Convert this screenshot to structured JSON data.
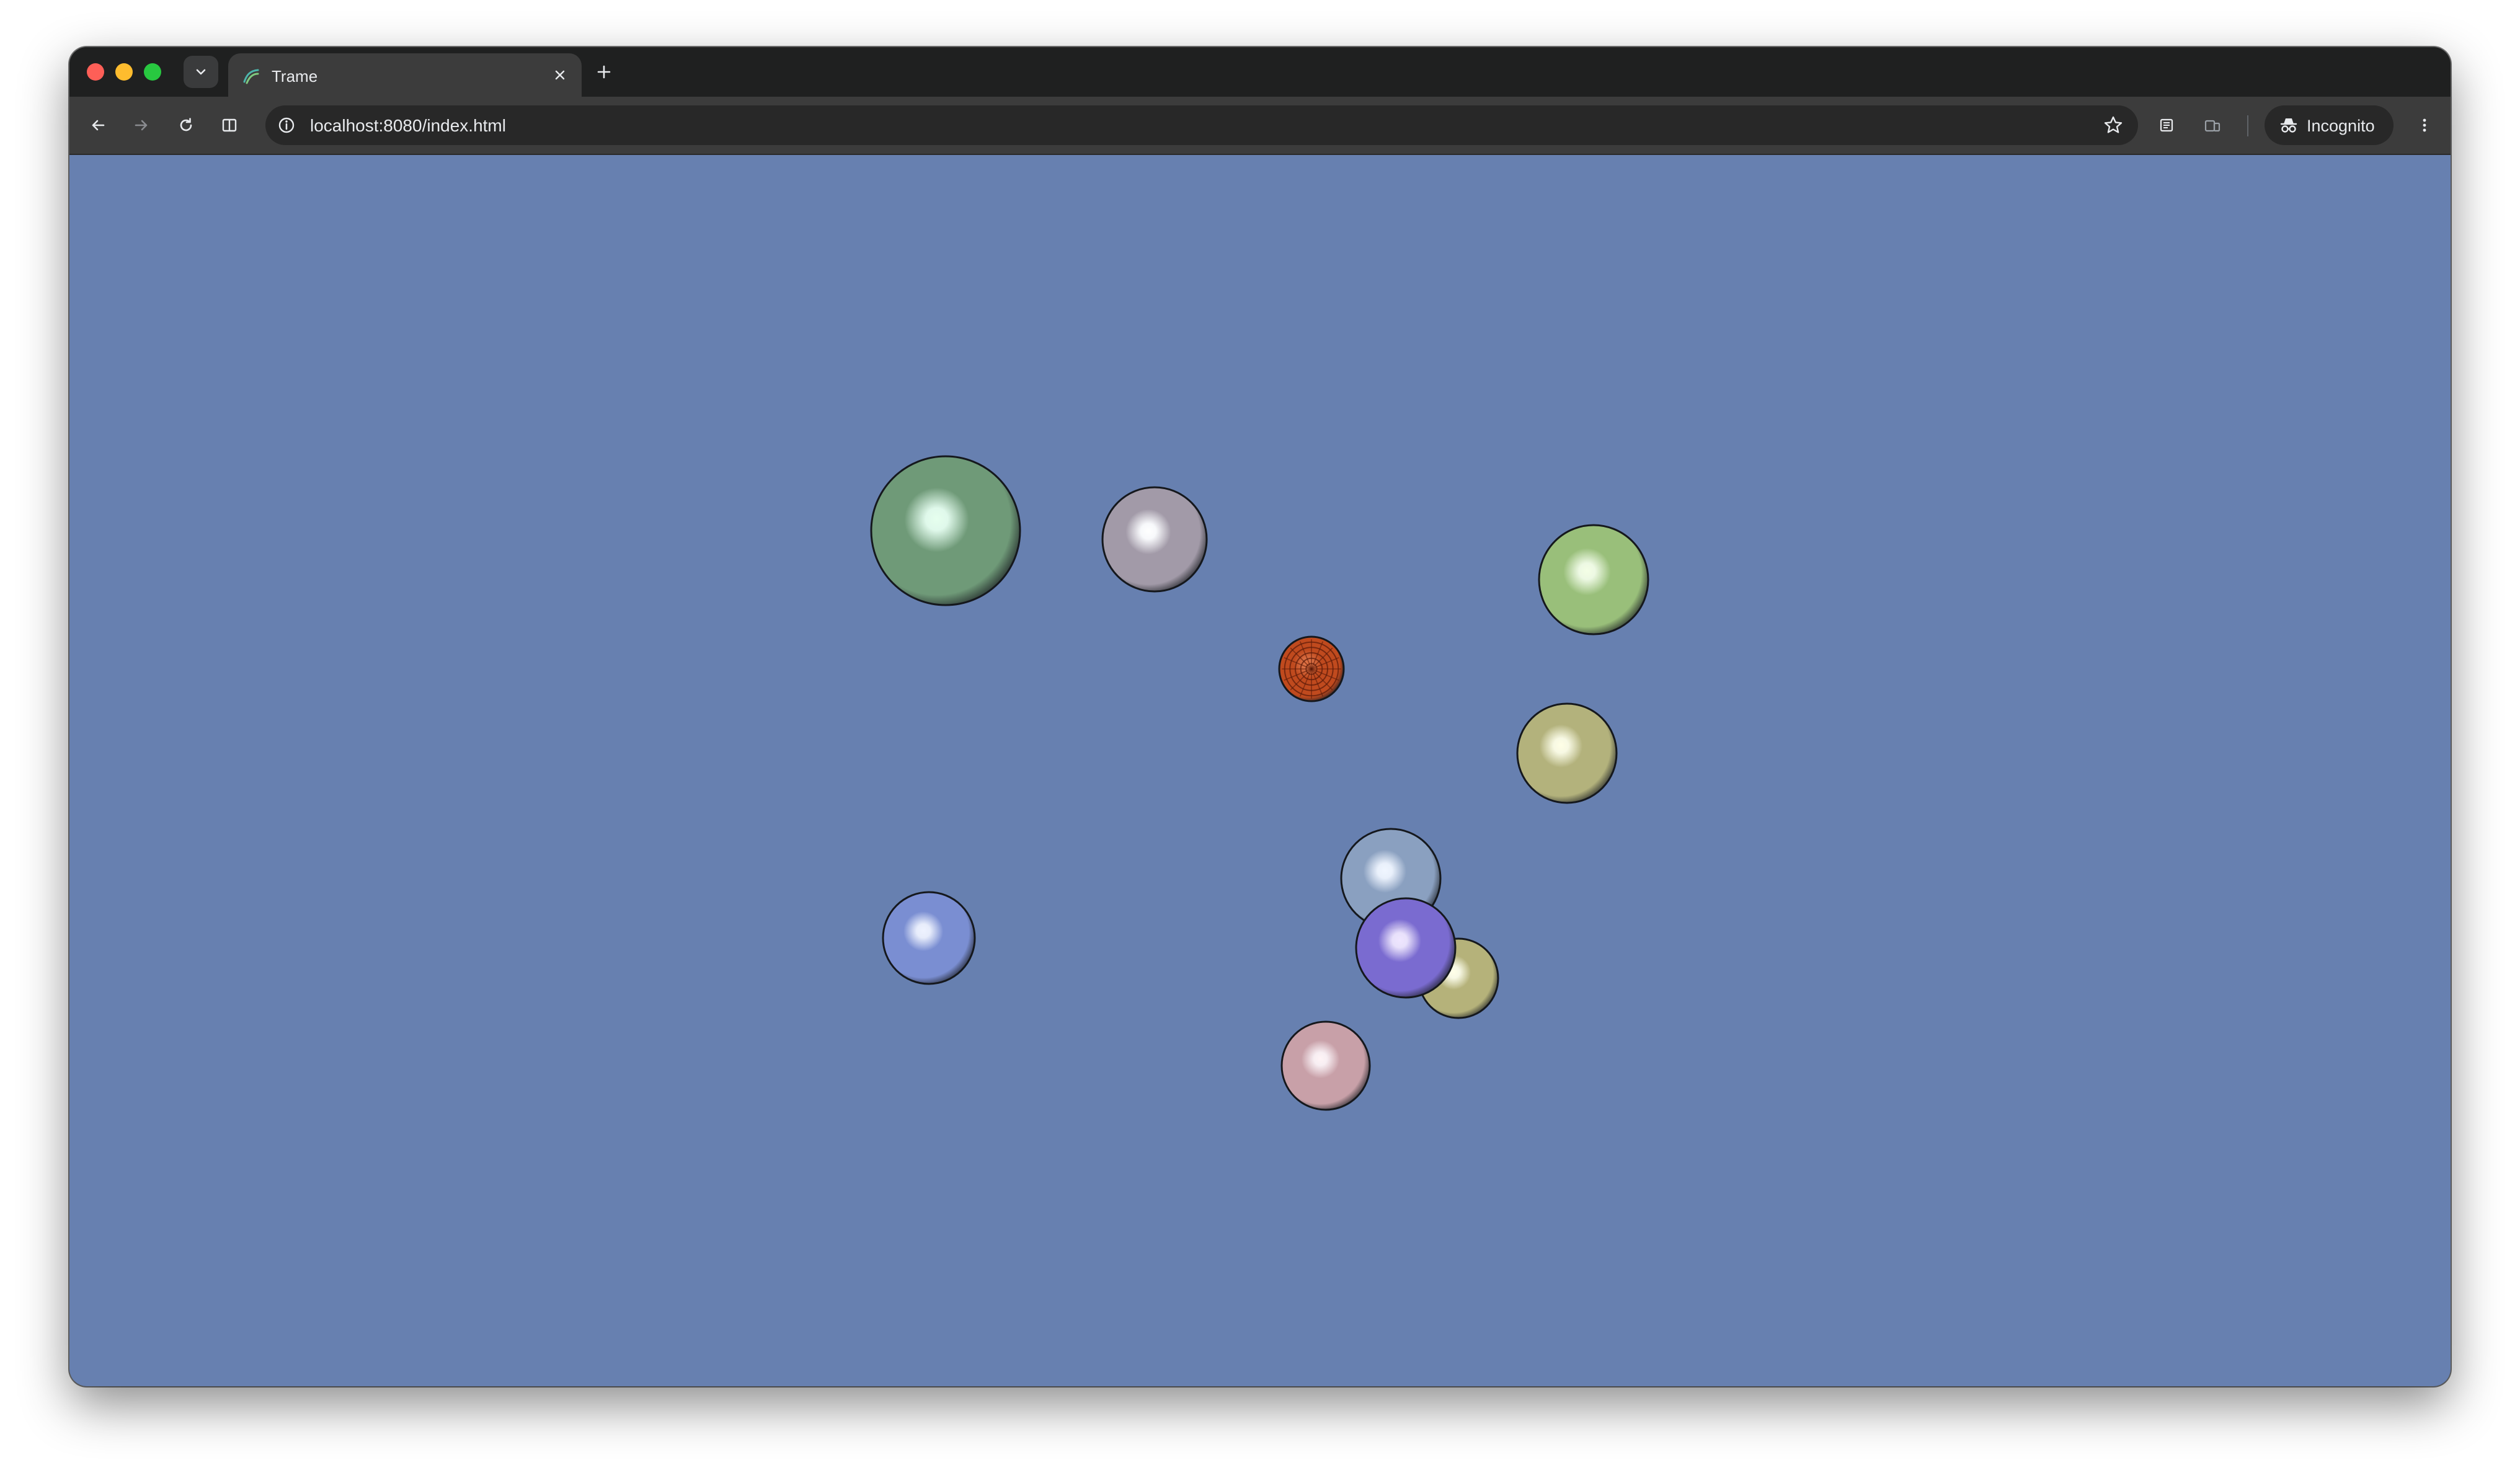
{
  "browser": {
    "tab": {
      "title": "Trame",
      "favicon_icon": "trame-logo-icon",
      "close_icon": "close-icon"
    },
    "tab_search_icon": "chevron-down-icon",
    "new_tab_icon": "plus-icon",
    "toolbar": {
      "back_icon": "arrow-left-icon",
      "forward_icon": "arrow-right-icon",
      "reload_icon": "reload-icon",
      "split_view_icon": "split-view-icon",
      "site_info_icon": "info-icon",
      "url": "localhost:8080/index.html",
      "bookmark_icon": "star-icon",
      "reading_list_icon": "reading-list-icon",
      "device_icon": "device-icon",
      "incognito_label": "Incognito",
      "incognito_icon": "incognito-icon",
      "menu_icon": "kebab-menu-icon"
    },
    "traffic_lights": {
      "close": "#fe5f57",
      "minimize": "#febc2e",
      "maximize": "#28c840"
    }
  },
  "render_view": {
    "background_color": "#6780b0",
    "spheres": [
      {
        "color": "#6f9a78",
        "highlight": "#e6ffee"
      },
      {
        "color": "#a29aa8",
        "highlight": "#ffffff"
      },
      {
        "color": "#99bf7a",
        "highlight": "#f4ffe6"
      },
      {
        "color": "#c04a1e",
        "highlight": "#e07040",
        "textured": true
      },
      {
        "color": "#b3b27c",
        "highlight": "#ffffe6"
      },
      {
        "color": "#7a6bd0",
        "highlight": "#efe6ff"
      },
      {
        "color": "#8aa0c0",
        "highlight": "#f0f6ff"
      },
      {
        "color": "#b5b27a",
        "highlight": "#ffffe8"
      },
      {
        "color": "#7a8ed2",
        "highlight": "#eef2ff"
      },
      {
        "color": "#c8a0a8",
        "highlight": "#fff4f6"
      }
    ]
  }
}
